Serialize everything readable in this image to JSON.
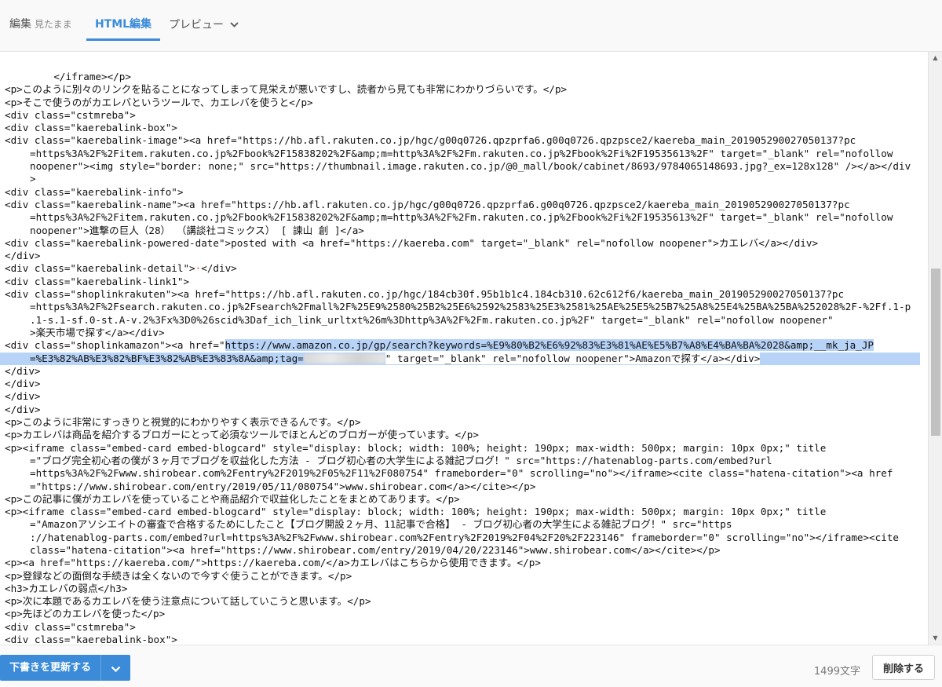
{
  "tabs": {
    "edit_label": "編集",
    "edit_sub": "見たまま",
    "html_label": "HTML編集",
    "preview_label": "プレビュー"
  },
  "code_lines": [
    "    </iframe></p>",
    "<p>このように別々のリンクを貼ることになってしまって見栄えが悪いですし、読者から見ても非常にわかりづらいです。</p>",
    "<p>そこで使うのがカエレバというツールで、カエレバを使うと</p>",
    "<div class=\"cstmreba\">",
    "<div class=\"kaerebalink-box\">",
    "<div class=\"kaerebalink-image\"><a href=\"https://hb.afl.rakuten.co.jp/hgc/g00q0726.qpzprfa6.g00q0726.qpzpsce2/kaereba_main_201905290027050137?pc",
    "=https%3A%2F%2Fitem.rakuten.co.jp%2Fbook%2F15838202%2F&amp;m=http%3A%2F%2Fm.rakuten.co.jp%2Fbook%2Fi%2F19535613%2F\" target=\"_blank\" rel=\"nofollow",
    "noopener\"><img style=\"border: none;\" src=\"https://thumbnail.image.rakuten.co.jp/@0_mall/book/cabinet/8693/9784065148693.jpg?_ex=128x128\" /></a></div",
    ">",
    "<div class=\"kaerebalink-info\">",
    "<div class=\"kaerebalink-name\"><a href=\"https://hb.afl.rakuten.co.jp/hgc/g00q0726.qpzprfa6.g00q0726.qpzpsce2/kaereba_main_201905290027050137?pc",
    "=https%3A%2F%2Fitem.rakuten.co.jp%2Fbook%2F15838202%2F&amp;m=http%3A%2F%2Fm.rakuten.co.jp%2Fbook%2Fi%2F19535613%2F\" target=\"_blank\" rel=\"nofollow",
    "noopener\">進撃の巨人（28） （講談社コミックス） [ 諫山 創 ]</a>",
    "<div class=\"kaerebalink-powered-date\">posted with <a href=\"https://kaereba.com\" target=\"_blank\" rel=\"nofollow noopener\">カエレバ</a></div>",
    "</div>",
    "<div class=\"kaerebalink-detail\">",
    "<div class=\"kaerebalink-link1\">",
    "<div class=\"shoplinkrakuten\"><a href=\"https://hb.afl.rakuten.co.jp/hgc/184cb30f.95b1b1c4.184cb310.62c612f6/kaereba_main_201905290027050137?pc",
    "=https%3A%2F%2Fsearch.rakuten.co.jp%2Fsearch%2Fmall%2F%25E9%2580%25B2%25E6%2592%2583%25E3%2581%25AE%25E5%25B7%25A8%25E4%25BA%25BA%252028%2F-%2Ff.1-p",
    ".1-s.1-sf.0-st.A-v.2%3Fx%3D0%26scid%3Daf_ich_link_urltxt%26m%3Dhttp%3A%2F%2Fm.rakuten.co.jp%2F\" target=\"_blank\" rel=\"nofollow noopener\"",
    ">楽天市場で探す</a></div>",
    "<div class=\"shoplinkamazon\"><a href=\"",
    "https://www.amazon.co.jp/gp/search?keywords=%E9%80%B2%E6%92%83%E3%81%AE%E5%B7%A8%E4%BA%BA%2028&amp;__mk_ja_JP",
    "=%E3%82%AB%E3%82%BF%E3%82%AB%E3%83%8A&amp;tag=",
    "\" target=\"_blank\" rel=\"nofollow noopener\">Amazonで探す</a></div>",
    "</div>",
    "</div>",
    "</div>",
    "</div>",
    "<p>このように非常にすっきりと視覚的にわかりやすく表示できるんです。</p>",
    "<p>カエレバは商品を紹介するブロガーにとって必須なツールでほとんどのブロガーが使っています。</p>",
    "<p><iframe class=\"embed-card embed-blogcard\" style=\"display: block; width: 100%; height: 190px; max-width: 500px; margin: 10px 0px;\" title",
    "=\"ブログ完全初心者の僕が３ヶ月でブログを収益化した方法 - ブログ初心者の大学生による雑記ブログ！\" src=\"https://hatenablog-parts.com/embed?url",
    "=https%3A%2F%2Fwww.shirobear.com%2Fentry%2F2019%2F05%2F11%2F080754\" frameborder=\"0\" scrolling=\"no\"></iframe><cite class=\"hatena-citation\"><a href",
    "=\"https://www.shirobear.com/entry/2019/05/11/080754\">www.shirobear.com</a></cite></p>",
    "<p>この記事に僕がカエレバを使っていることや商品紹介で収益化したことをまとめてあります。</p>",
    "<p><iframe class=\"embed-card embed-blogcard\" style=\"display: block; width: 100%; height: 190px; max-width: 500px; margin: 10px 0px;\" title",
    "=\"Amazonアソシエイトの審査で合格するためにしたこと【ブログ開設２ヶ月、11記事で合格】 - ブログ初心者の大学生による雑記ブログ！\" src=\"https",
    "://hatenablog-parts.com/embed?url=https%3A%2F%2Fwww.shirobear.com%2Fentry%2F2019%2F04%2F20%2F223146\" frameborder=\"0\" scrolling=\"no\"></iframe><cite",
    "class=\"hatena-citation\"><a href=\"https://www.shirobear.com/entry/2019/04/20/223146\">www.shirobear.com</a></cite></p>",
    "<p><a href=\"https://kaereba.com/\">https://kaereba.com/</a>カエレバはこちらから使用できます。</p>",
    "<p>登録などの面倒な手続きは全くないので今すぐ使うことができます。</p>",
    "<h3>カエレバの弱点</h3>",
    "<p>次に本題であるカエレバを使う注意点について話していこうと思います。</p>",
    "<p>先ほどのカエレバを使った</p>",
    "<div class=\"cstmreba\">",
    "<div class=\"kaerebalink-box\">"
  ],
  "footer": {
    "save_label": "下書きを更新する",
    "char_count": "1499文字",
    "delete_label": "削除する"
  },
  "colors": {
    "accent": "#3b8bd9",
    "selection": "#b7d3f7"
  }
}
